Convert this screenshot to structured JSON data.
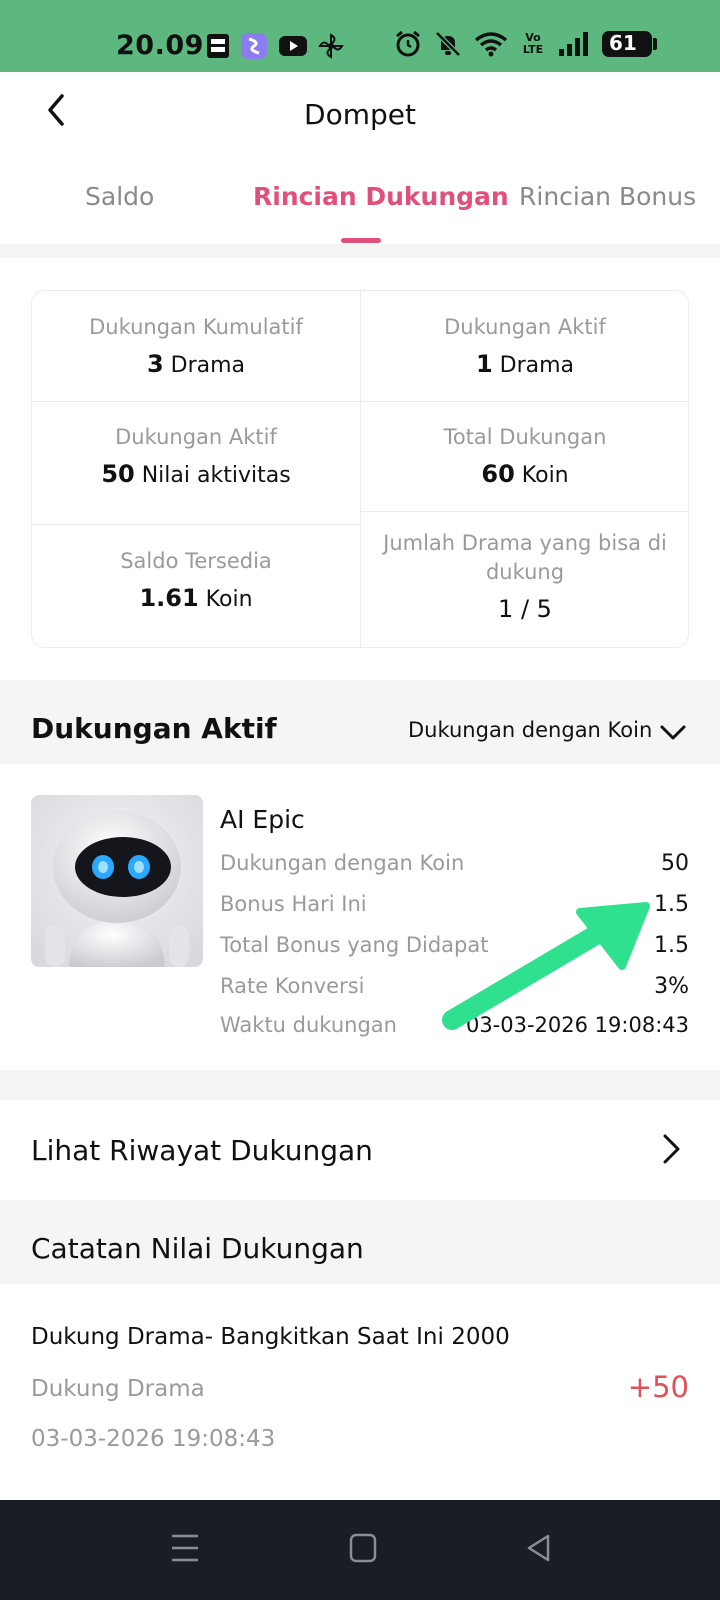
{
  "status_bar": {
    "time": "20.09",
    "battery": "61",
    "icons_left": [
      "brimo-icon",
      "assistant-icon",
      "youtube-icon",
      "pinwheel-icon"
    ],
    "icons_right": [
      "alarm-icon",
      "mute-bell-icon",
      "wifi-icon",
      "volte-icon",
      "signal-icon",
      "battery-icon"
    ],
    "volte_text": "Vo LTE"
  },
  "header": {
    "title": "Dompet"
  },
  "tabs": [
    {
      "label": "Saldo",
      "active": false
    },
    {
      "label": "Rincian Dukungan",
      "active": true
    },
    {
      "label": "Rincian Bonus",
      "active": false
    }
  ],
  "stats": {
    "cumulative": {
      "label": "Dukungan Kumulatif",
      "value": "3",
      "unit": " Drama"
    },
    "active_drama": {
      "label": "Dukungan Aktif",
      "value": "1",
      "unit": " Drama"
    },
    "active_value": {
      "label": "Dukungan Aktif",
      "value": "50",
      "unit": " Nilai aktivitas"
    },
    "total": {
      "label": "Total Dukungan",
      "value": "60",
      "unit": " Koin"
    },
    "balance": {
      "label": "Saldo Tersedia",
      "value": "1.61",
      "unit": " Koin"
    },
    "drama_count": {
      "label": "Jumlah Drama yang bisa di dukung",
      "value": "1 / 5"
    }
  },
  "active_support": {
    "title": "Dukungan Aktif",
    "filter": "Dukungan dengan Koin",
    "item": {
      "name": "AI Epic",
      "rows": [
        {
          "label": "Dukungan dengan Koin",
          "value": "50"
        },
        {
          "label": "Bonus Hari Ini",
          "value": "1.5"
        },
        {
          "label": "Total Bonus yang Didapat",
          "value": "1.5"
        },
        {
          "label": "Rate Konversi",
          "value": "3%"
        },
        {
          "label": "Waktu dukungan",
          "value": "03-03-2026 19:08:43"
        }
      ]
    }
  },
  "history_link": {
    "label": "Lihat Riwayat Dukungan"
  },
  "records": {
    "title": "Catatan Nilai Dukungan",
    "items": [
      {
        "title": "Dukung Drama-  Bangkitkan Saat Ini 2000",
        "type": "Dukung Drama",
        "date": "03-03-2026 19:08:43",
        "amount": "+50"
      }
    ]
  },
  "colors": {
    "accent": "#e0507a",
    "status_bar": "#5cb87f",
    "arrow": "#2fe08f",
    "navbar": "#1b1d24"
  }
}
